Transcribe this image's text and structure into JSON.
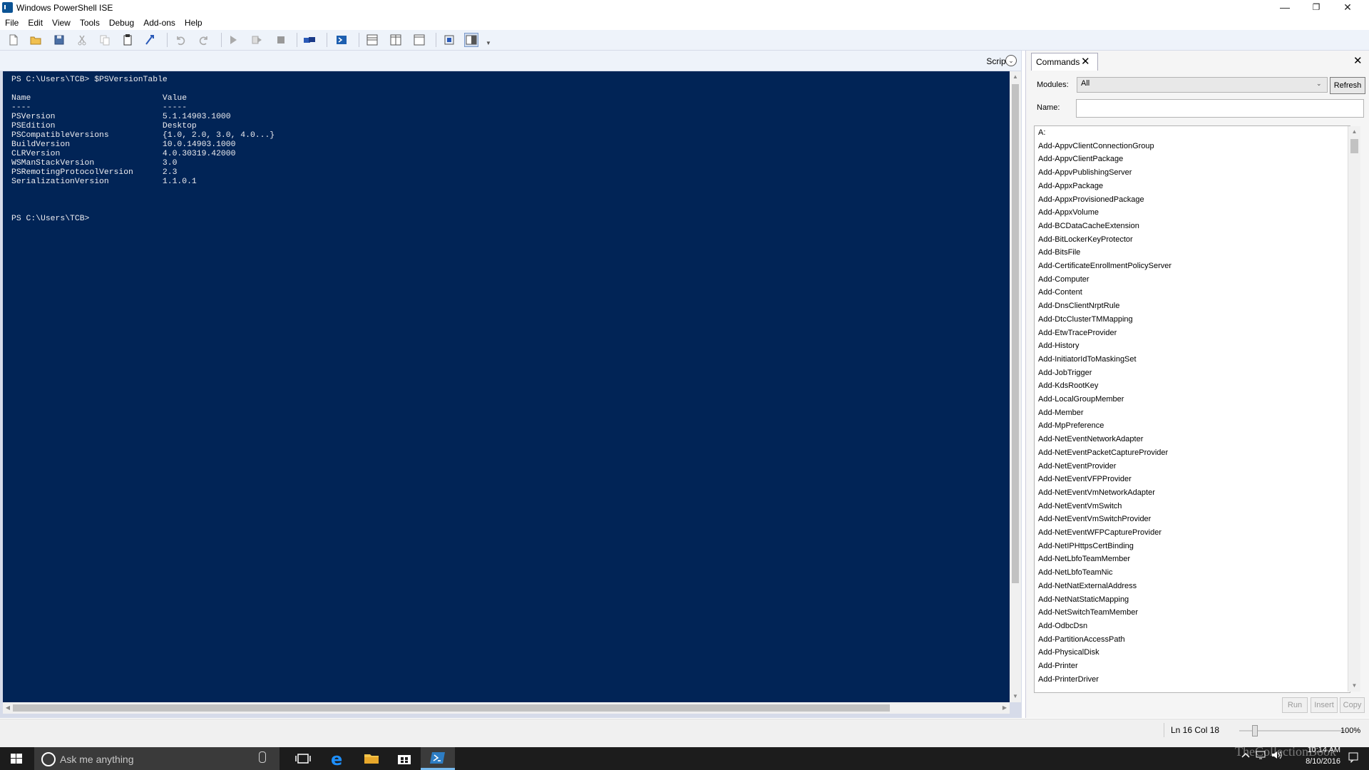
{
  "window": {
    "title": "Windows PowerShell ISE"
  },
  "menu": [
    "File",
    "Edit",
    "View",
    "Tools",
    "Debug",
    "Add-ons",
    "Help"
  ],
  "script_bar": {
    "label": "Script"
  },
  "console": {
    "lines": [
      "PS C:\\Users\\TCB> $PSVersionTable",
      "",
      "Name                           Value",
      "----                           -----",
      "PSVersion                      5.1.14903.1000",
      "PSEdition                      Desktop",
      "PSCompatibleVersions           {1.0, 2.0, 3.0, 4.0...}",
      "BuildVersion                   10.0.14903.1000",
      "CLRVersion                     4.0.30319.42000",
      "WSManStackVersion              3.0",
      "PSRemotingProtocolVersion      2.3",
      "SerializationVersion           1.1.0.1",
      "",
      "",
      "",
      "PS C:\\Users\\TCB>"
    ],
    "background": "#012456",
    "foreground": "#eeedf0"
  },
  "commands": {
    "tab_label": "Commands",
    "modules_label": "Modules:",
    "modules_value": "All",
    "refresh_label": "Refresh",
    "name_label": "Name:",
    "name_value": "",
    "items": [
      "A:",
      "Add-AppvClientConnectionGroup",
      "Add-AppvClientPackage",
      "Add-AppvPublishingServer",
      "Add-AppxPackage",
      "Add-AppxProvisionedPackage",
      "Add-AppxVolume",
      "Add-BCDataCacheExtension",
      "Add-BitLockerKeyProtector",
      "Add-BitsFile",
      "Add-CertificateEnrollmentPolicyServer",
      "Add-Computer",
      "Add-Content",
      "Add-DnsClientNrptRule",
      "Add-DtcClusterTMMapping",
      "Add-EtwTraceProvider",
      "Add-History",
      "Add-InitiatorIdToMaskingSet",
      "Add-JobTrigger",
      "Add-KdsRootKey",
      "Add-LocalGroupMember",
      "Add-Member",
      "Add-MpPreference",
      "Add-NetEventNetworkAdapter",
      "Add-NetEventPacketCaptureProvider",
      "Add-NetEventProvider",
      "Add-NetEventVFPProvider",
      "Add-NetEventVmNetworkAdapter",
      "Add-NetEventVmSwitch",
      "Add-NetEventVmSwitchProvider",
      "Add-NetEventWFPCaptureProvider",
      "Add-NetIPHttpsCertBinding",
      "Add-NetLbfoTeamMember",
      "Add-NetLbfoTeamNic",
      "Add-NetNatExternalAddress",
      "Add-NetNatStaticMapping",
      "Add-NetSwitchTeamMember",
      "Add-OdbcDsn",
      "Add-PartitionAccessPath",
      "Add-PhysicalDisk",
      "Add-Printer",
      "Add-PrinterDriver"
    ],
    "buttons": {
      "run": "Run",
      "insert": "Insert",
      "copy": "Copy"
    }
  },
  "status": {
    "position": "Ln 16  Col 18",
    "zoom": "100%",
    "zoom_fraction": 0.14
  },
  "taskbar": {
    "search_placeholder": "Ask me anything",
    "time": "10:14 AM",
    "date": "8/10/2016",
    "watermark": "TheCollectionBook"
  }
}
